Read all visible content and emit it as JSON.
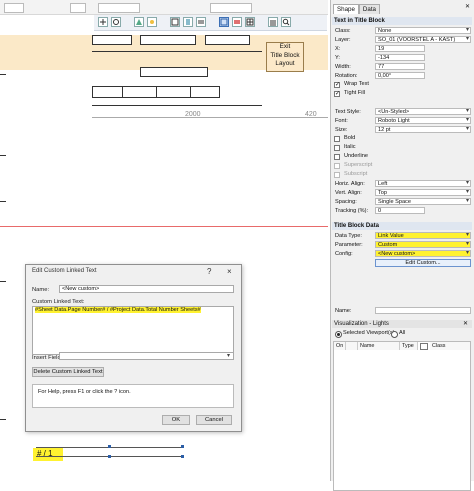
{
  "canvas": {
    "exit_button": [
      "Exit",
      "Title Block",
      "Layout"
    ],
    "dim_left": "2000",
    "dim_right": "420",
    "selection_text": "# / 1"
  },
  "dialog": {
    "title": "Edit Custom Linked Text",
    "help_glyph": "?",
    "close_glyph": "×",
    "name_label": "Name:",
    "name_value": "<New custom>",
    "custom_text_label": "Custom Linked Text:",
    "custom_text_value": "#Sheet Data.Page Number# / #Project Data.Total Number Sheets#",
    "insert_field_label": "Insert Field:",
    "insert_field_value": "",
    "delete_button": "Delete Custom Linked Text",
    "help_text": "For Help, press F1 or click the ? icon.",
    "ok": "OK",
    "cancel": "Cancel"
  },
  "panel": {
    "tabs": [
      "Shape",
      "Data"
    ],
    "section_title": "Text in Title Block",
    "class_label": "Class:",
    "class_value": "None",
    "layer_label": "Layer:",
    "layer_value": "SO_01 (VOORSTEL A - KAST)",
    "x_label": "X:",
    "x_value": "19",
    "y_label": "Y:",
    "y_value": "-134",
    "width_label": "Width:",
    "width_value": "77",
    "rotation_label": "Rotation:",
    "rotation_value": "0,00°",
    "wrap_text": "Wrap Text",
    "tight_fill": "Tight Fill",
    "text_style_label": "Text Style:",
    "text_style_value": "<Un-Styled>",
    "font_label": "Font:",
    "font_value": "Roboto Light",
    "size_label": "Size:",
    "size_value": "12 pt",
    "bold": "Bold",
    "italic": "Italic",
    "underline": "Underline",
    "superscript": "Superscript",
    "subscript": "Subscript",
    "horiz_align_label": "Horiz. Align:",
    "horiz_align_value": "Left",
    "vert_align_label": "Vert. Align:",
    "vert_align_value": "Top",
    "spacing_label": "Spacing:",
    "spacing_value": "Single Space",
    "tracking_label": "Tracking (%):",
    "tracking_value": "0",
    "title_block_data": "Title Block Data",
    "data_type_label": "Data Type:",
    "data_type_value": "Link Value",
    "parameter_label": "Parameter:",
    "parameter_value": "Custom",
    "config_label": "Config:",
    "config_value": "<New custom>",
    "edit_custom": "Edit Custom...",
    "name_label": "Name:",
    "viz_title": "Visualization - Lights",
    "radio_selected": "Selected Viewport(s)",
    "radio_all": "All",
    "col_on": "On",
    "col_icon": "",
    "col_name": "Name",
    "col_type": "Type",
    "col_class": "Class"
  },
  "colors": {
    "highlight": "#fff230",
    "canvas_band": "#fbe9c8",
    "red_line": "#e86a6a"
  }
}
